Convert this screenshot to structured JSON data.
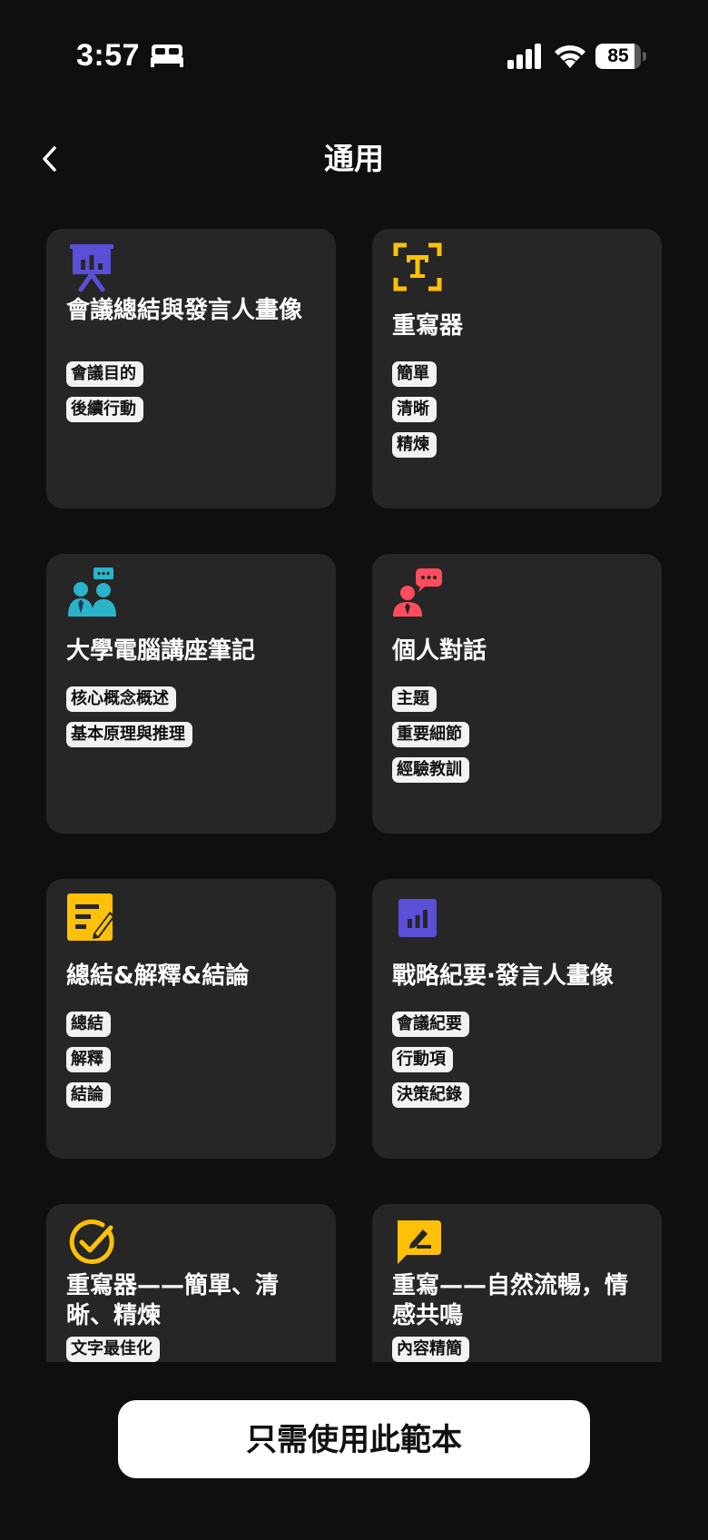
{
  "status_bar": {
    "time": "3:57",
    "battery_level": "85",
    "battery_fraction": 0.85,
    "icons": [
      "bed-icon",
      "cellular-signal-icon",
      "wifi-icon",
      "battery-icon"
    ]
  },
  "nav": {
    "title": "通用",
    "back_icon": "chevron-left-icon"
  },
  "colors": {
    "background": "#0f0f0f",
    "card": "#262626",
    "tag_bg": "#f2f2f2",
    "icon_purple": "#5a4fd6",
    "icon_yellow": "#ffc107",
    "icon_teal": "#2bb3c9",
    "icon_red": "#ff4d5e"
  },
  "templates": [
    {
      "title": "會議總結與發言人畫像",
      "icon": "presentation-board-icon",
      "tags": [
        "會議目的",
        "後續行動"
      ]
    },
    {
      "title": "重寫器",
      "icon": "text-scan-icon",
      "tags": [
        "簡單",
        "清晰",
        "精煉"
      ]
    },
    {
      "title": "大學電腦講座筆記",
      "icon": "lecture-people-icon",
      "tags": [
        "核心概念概述",
        "基本原理與推理"
      ]
    },
    {
      "title": "個人對話",
      "icon": "person-chat-icon",
      "tags": [
        "主題",
        "重要細節",
        "經驗教訓"
      ]
    },
    {
      "title": "總結&解釋&結論",
      "icon": "note-edit-icon",
      "tags": [
        "總結",
        "解釋",
        "結論"
      ]
    },
    {
      "title": "戰略紀要·發言人畫像",
      "icon": "bar-chart-icon",
      "tags": [
        "會議紀要",
        "行動項",
        "決策紀錄"
      ]
    },
    {
      "title": "重寫器——簡單、清晰、精煉",
      "icon": "check-circle-icon",
      "tags": [
        "文字最佳化"
      ]
    },
    {
      "title": "重寫——自然流暢，情感共鳴",
      "icon": "pen-comment-icon",
      "tags": [
        "內容精簡"
      ]
    }
  ],
  "footer": {
    "button_label": "只需使用此範本"
  }
}
